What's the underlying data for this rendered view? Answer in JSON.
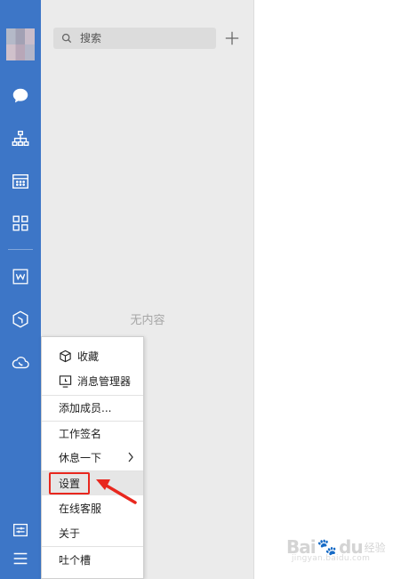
{
  "search": {
    "placeholder": "搜索"
  },
  "list": {
    "empty_text": "无内容"
  },
  "menu": {
    "items": [
      {
        "label": "收藏",
        "icon": "cube-icon"
      },
      {
        "label": "消息管理器",
        "icon": "message-manager-icon"
      },
      {
        "label": "添加成员..."
      },
      {
        "label": "工作签名"
      },
      {
        "label": "休息一下"
      },
      {
        "label": "设置"
      },
      {
        "label": "在线客服"
      },
      {
        "label": "关于"
      },
      {
        "label": "吐个槽"
      }
    ]
  },
  "watermark": {
    "brand": "Bai",
    "paw": "🐾",
    "brand2": "du",
    "sub": "经验",
    "url": "jingyan.baidu.com"
  },
  "colors": {
    "sidebar": "#3d76c7",
    "list_bg": "#ebebeb",
    "highlight": "#e8271e"
  }
}
